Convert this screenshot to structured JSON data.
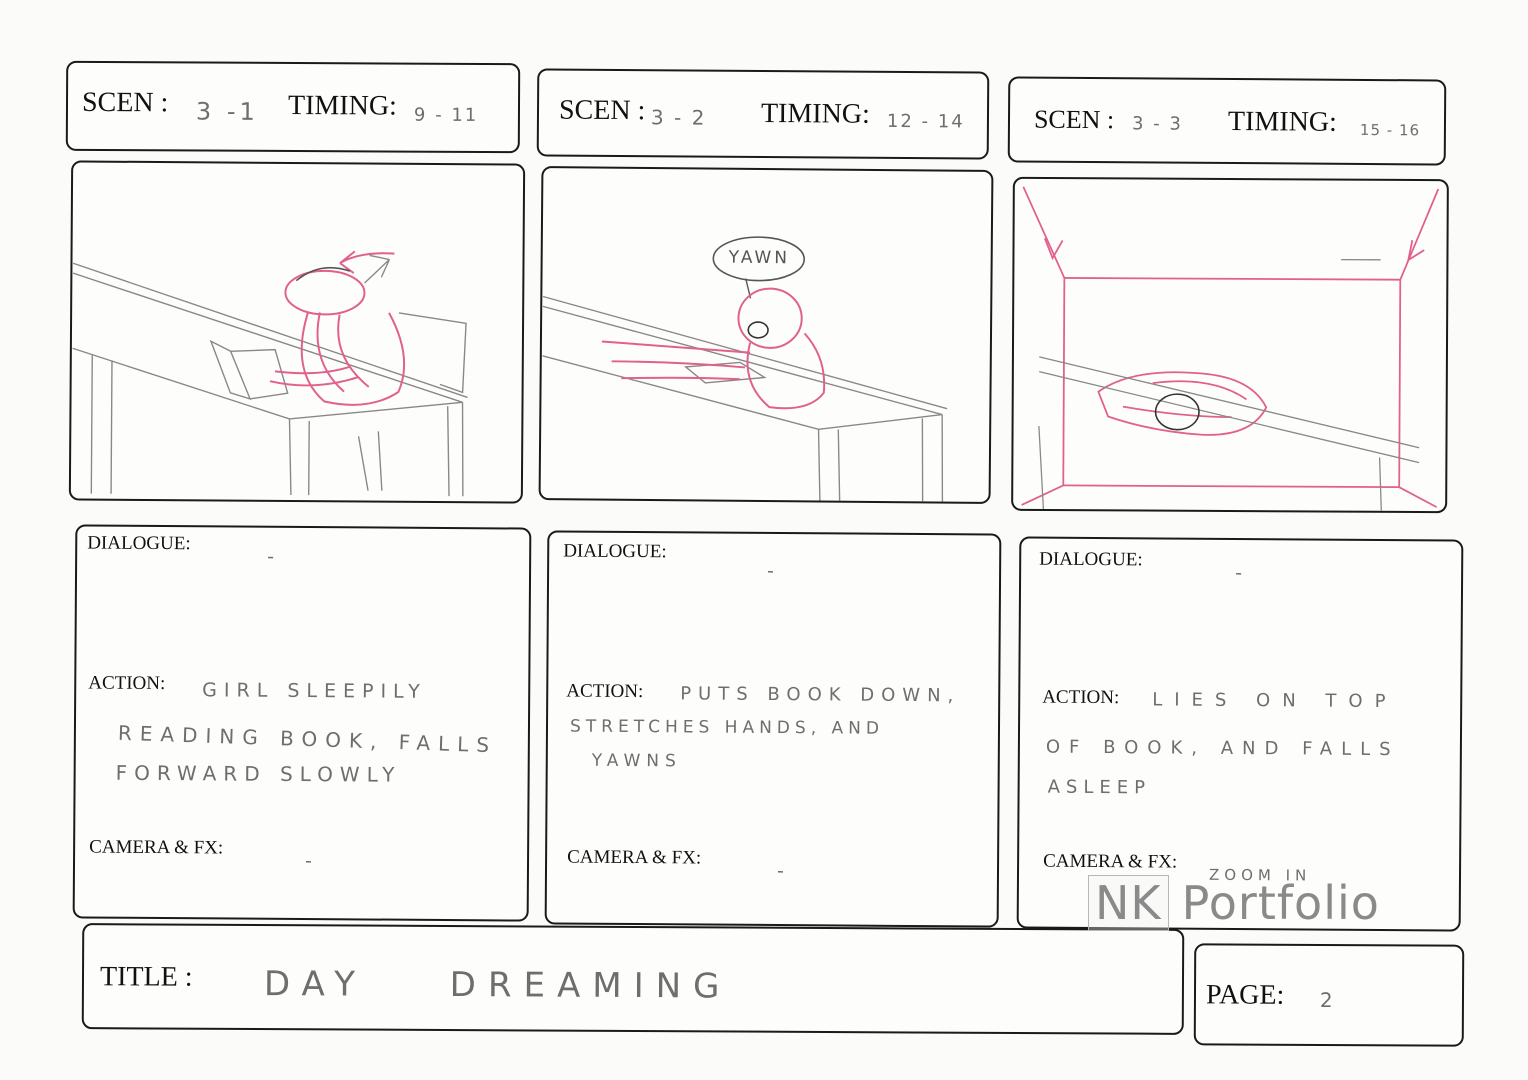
{
  "panels": [
    {
      "scene_label": "SCEN :",
      "scene_value": "3 -1",
      "timing_label": "TIMING:",
      "timing_value": "9 - 11",
      "dialogue_label": "DIALOGUE:",
      "dialogue_value": "-",
      "action_label": "ACTION:",
      "action_lines": [
        "GIRL SLEEPILY",
        "READING BOOK, FALLS",
        "FORWARD SLOWLY"
      ],
      "camera_label": "CAMERA & FX:",
      "camera_value": "-"
    },
    {
      "scene_label": "SCEN :",
      "scene_value": "3 - 2",
      "timing_label": "TIMING:",
      "timing_value": "12 - 14",
      "dialogue_label": "DIALOGUE:",
      "dialogue_value": "-",
      "speech_bubble": "YAWN",
      "action_label": "ACTION:",
      "action_lines": [
        "PUTS BOOK DOWN,",
        "STRETCHES HANDS, AND",
        "YAWNS"
      ],
      "camera_label": "CAMERA & FX:",
      "camera_value": "-"
    },
    {
      "scene_label": "SCEN :",
      "scene_value": "3 - 3",
      "timing_label": "TIMING:",
      "timing_value": "15 - 16",
      "dialogue_label": "DIALOGUE:",
      "dialogue_value": "-",
      "action_label": "ACTION:",
      "action_lines": [
        "LIES ON TOP",
        "OF BOOK, AND FALLS",
        "ASLEEP"
      ],
      "camera_label": "CAMERA & FX:",
      "camera_value": "ZOOM IN"
    }
  ],
  "footer": {
    "title_label": "TITLE :",
    "title_value": "DAY DREAMING",
    "page_label": "PAGE:",
    "page_value": "2"
  },
  "watermark": {
    "left": "NK",
    "right": "Portfolio"
  },
  "colors": {
    "pencil": "#6e6e6e",
    "pink": "#e0608e",
    "ink": "#1a1a1a"
  }
}
